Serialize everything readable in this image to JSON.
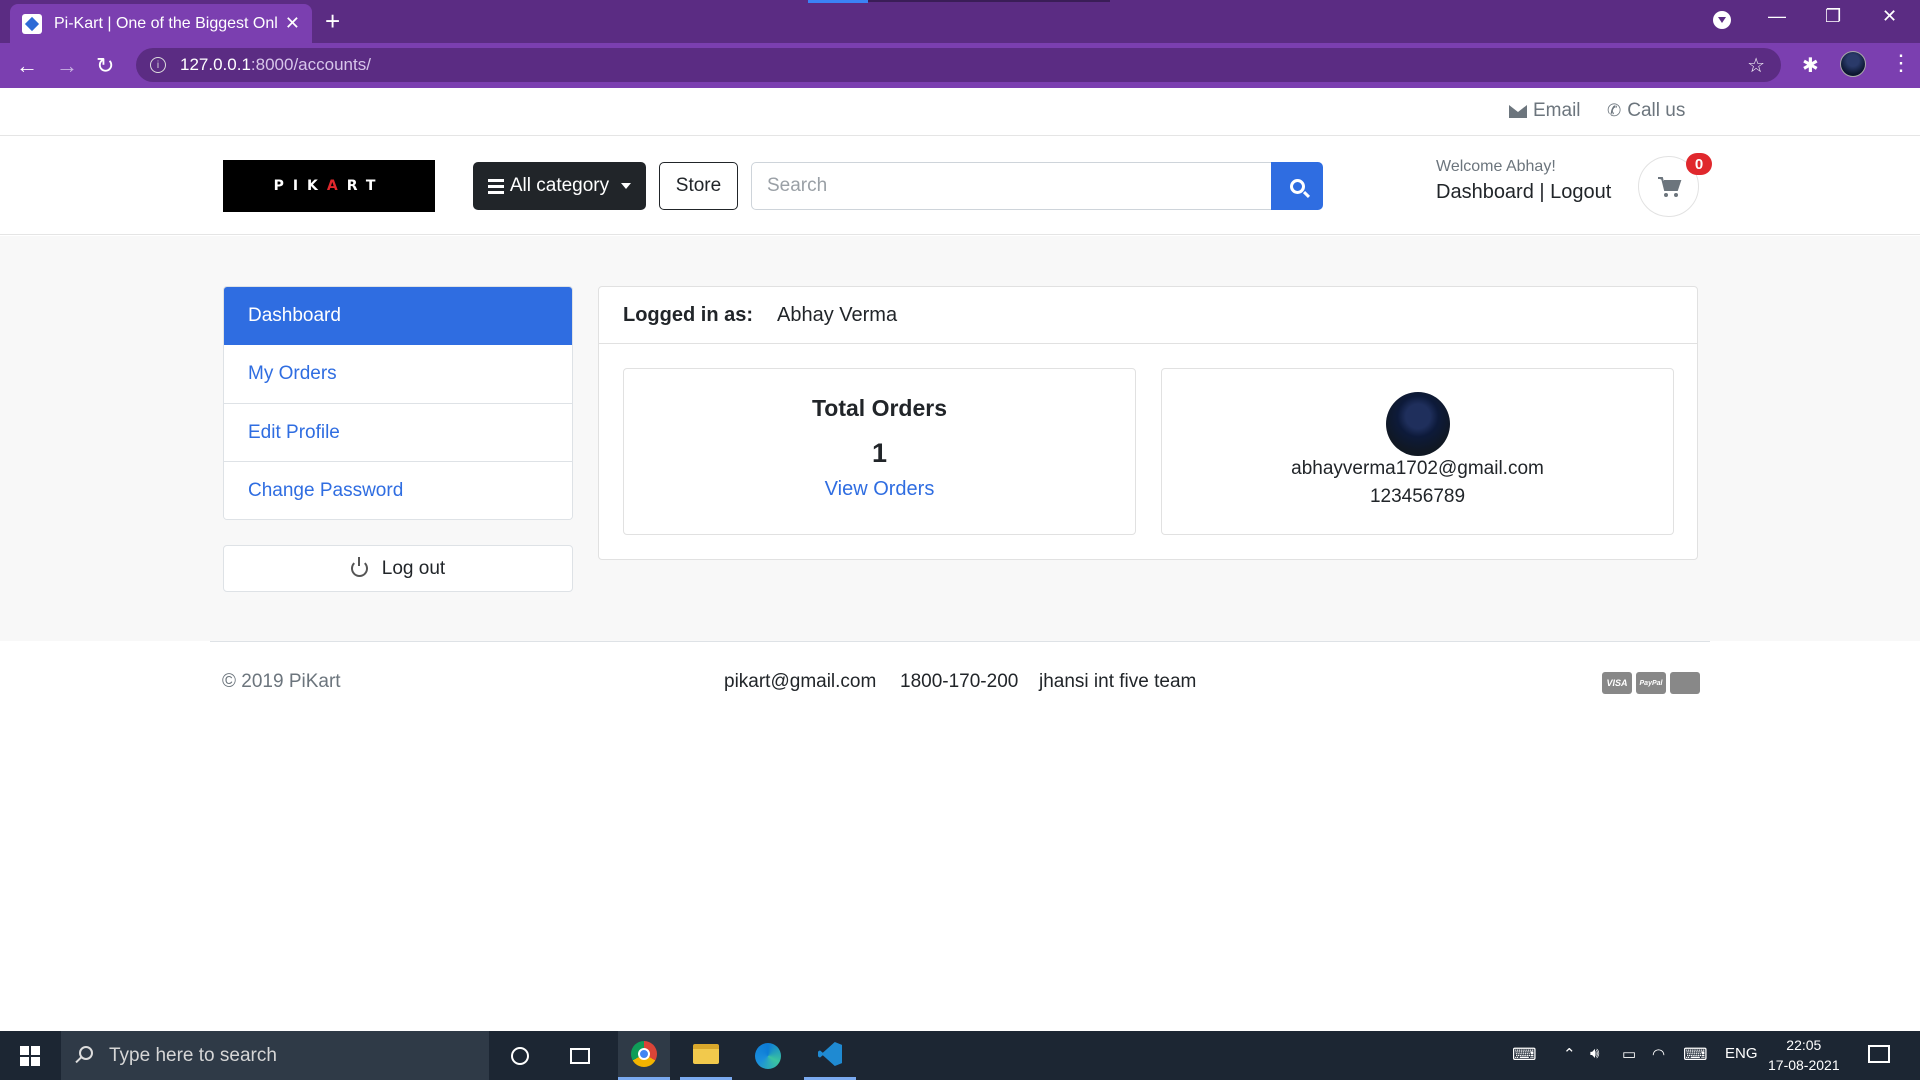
{
  "browser": {
    "tab_title": "Pi-Kart | One of the Biggest Onli",
    "url_host": "127.0.0.1",
    "url_path": ":8000/accounts/"
  },
  "topbar": {
    "email_label": "Email",
    "call_label": "Call us"
  },
  "header": {
    "logo_text": "PIKART",
    "category_label": "All category",
    "store_label": "Store",
    "search_placeholder": "Search",
    "welcome": "Welcome Abhay!",
    "dashboard_link": "Dashboard",
    "separator": "|",
    "logout_link": "Logout",
    "cart_count": "0"
  },
  "sidebar": {
    "items": [
      {
        "label": "Dashboard",
        "active": true
      },
      {
        "label": "My Orders"
      },
      {
        "label": "Edit Profile"
      },
      {
        "label": "Change Password"
      }
    ],
    "logout_label": "Log out"
  },
  "account": {
    "logged_in_label": "Logged in as:",
    "user_name": "Abhay Verma",
    "total_orders_label": "Total Orders",
    "total_orders_value": "1",
    "view_orders_label": "View Orders",
    "email": "abhayverma1702@gmail.com",
    "phone": "123456789"
  },
  "footer": {
    "copyright": "© 2019 PiKart",
    "email": "pikart@gmail.com",
    "phone": "1800-170-200",
    "team": "jhansi int five team",
    "payment_icons": [
      "VISA",
      "PayPal",
      "mastercard"
    ]
  },
  "taskbar": {
    "search_placeholder": "Type here to search",
    "language": "ENG",
    "time": "22:05",
    "date": "17-08-2021"
  },
  "colors": {
    "primary": "#2f6de1",
    "browser_frame": "#7b3fb0",
    "badge": "#e0282d"
  }
}
